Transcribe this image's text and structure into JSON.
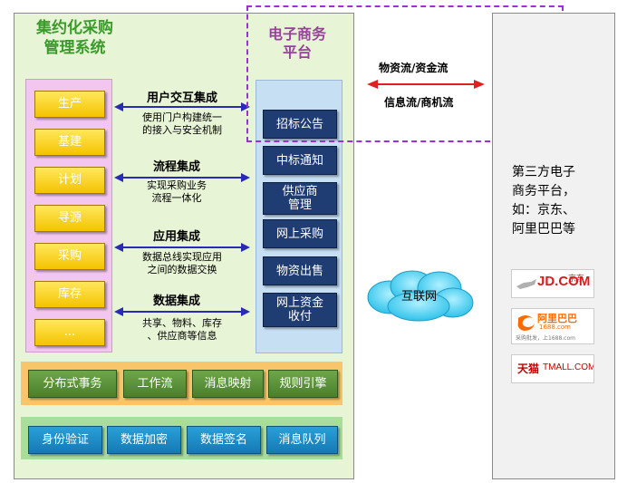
{
  "system": {
    "title_line1": "集约化采购",
    "title_line2": "管理系统"
  },
  "business_modules": [
    "生产",
    "基建",
    "计划",
    "寻源",
    "采购",
    "库存",
    "..."
  ],
  "integrations": [
    {
      "title": "用户交互集成",
      "desc1": "使用门户构建统一",
      "desc2": "的接入与安全机制"
    },
    {
      "title": "流程集成",
      "desc1": "实现采购业务",
      "desc2": "流程一体化"
    },
    {
      "title": "应用集成",
      "desc1": "数据总线实现应用",
      "desc2": "之间的数据交换"
    },
    {
      "title": "数据集成",
      "desc1": "共享、物料、库存",
      "desc2": "、供应商等信息"
    }
  ],
  "platform": {
    "title_line1": "电子商务",
    "title_line2": "平台",
    "items": [
      {
        "line1": "招标公告",
        "line2": ""
      },
      {
        "line1": "中标通知",
        "line2": ""
      },
      {
        "line1": "供应商",
        "line2": "管理"
      },
      {
        "line1": "网上采购",
        "line2": ""
      },
      {
        "line1": "物资出售",
        "line2": ""
      },
      {
        "line1": "网上资金",
        "line2": "收付"
      }
    ]
  },
  "middleware": [
    "分布式事务",
    "工作流",
    "消息映射",
    "规则引擎"
  ],
  "security": [
    "身份验证",
    "数据加密",
    "数据签名",
    "消息队列"
  ],
  "flows": {
    "top": "物资流/资金流",
    "bottom": "信息流/商机流"
  },
  "internet": "互联网",
  "third_party": {
    "line1": "第三方电子",
    "line2": "商务平台，",
    "line3": "如：京东、",
    "line4": "阿里巴巴等"
  },
  "logos": {
    "jd_text": "JD.COM",
    "jd_cn": "京东",
    "alibaba_cn": "阿里巴巴",
    "alibaba_url": "1688.com",
    "alibaba_slogan": "采购批发，上1688.com",
    "tmall_cn": "天猫",
    "tmall_en": "TMALL.COM"
  },
  "colors": {
    "left_panel": "#e8f4d6",
    "business_box": "#f2c6ee",
    "platform_box": "#c7dff3",
    "dashed_border": "#9a30d8",
    "arrow_blue": "#2a2ab8",
    "arrow_red": "#e02020"
  }
}
